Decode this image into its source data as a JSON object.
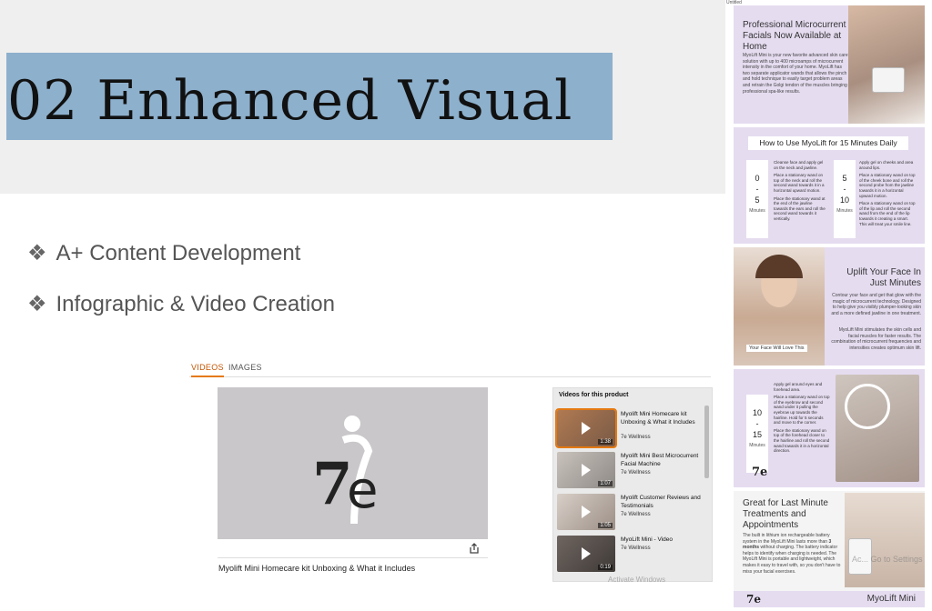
{
  "slide": {
    "title": "02 Enhanced Visual",
    "bullets": [
      {
        "icon": "diamond-bullet-icon",
        "text": "A+ Content Development"
      },
      {
        "icon": "diamond-bullet-icon",
        "text": "Infographic & Video Creation"
      }
    ]
  },
  "video_widget": {
    "tabs": [
      "VIDEOS",
      "IMAGES"
    ],
    "active_tab": "VIDEOS",
    "player_logo": "7e",
    "caption": "Myolift Mini Homecare kit Unboxing & What it Includes",
    "list_header": "Videos for this product",
    "videos": [
      {
        "title": "Myolift Mini Homecare kit Unboxing & What it Includes",
        "brand": "7e Wellness",
        "duration": "1:38"
      },
      {
        "title": "Myolift Mini Best Microcurrent Facial Machine",
        "brand": "7e Wellness",
        "duration": "1:07"
      },
      {
        "title": "Myolift Customer Reviews and Testimonials",
        "brand": "7e Wellness",
        "duration": "1:05"
      },
      {
        "title": "MyoLift Mini - Video",
        "brand": "7e Wellness",
        "duration": "0:19"
      }
    ],
    "watermark": "Activate Windows"
  },
  "infographic": {
    "corner_label": "Untitled",
    "panel1": {
      "title": "Professional Microcurrent Facials Now Available at Home",
      "text": "MyoLift Mini is your new favorite advanced skin care solution with up to 400 microamps of microcurrent intensity in the comfort of your home. MyoLift has two separate applicator wands that allows the pinch and hold technique to easily target problem areas and retrain the Golgi tendon of the muscles bringing professional spa-like results."
    },
    "panel2": {
      "title": "How to Use MyoLift for 15 Minutes Daily",
      "block1": {
        "from": "0",
        "to": "5",
        "unit": "Minutes",
        "steps": [
          "Cleanse face and apply gel on the neck and jawline.",
          "Place a stationary wand on top of the neck and roll the second wand towards it in a horizontal upward motion.",
          "Place the stationary wand at the end of the jawline towards the ears and roll the second wand towards it vertically."
        ]
      },
      "block2": {
        "from": "5",
        "to": "10",
        "unit": "Minutes",
        "steps": [
          "Apply gel on cheeks and area around lips.",
          "Place a stationary wand on top of the cheek bone and roll the second probe from the jawline towards it in a horizontal upward motion.",
          "Place a stationary wand on top of the lip and roll the second wand from the end of the lip towards it creating a smart. This will treat your smile line."
        ]
      }
    },
    "panel3": {
      "title": "Uplift Your Face In Just Minutes",
      "badge": "Your Face Will Love This",
      "text1": "Contour your face and get that glow with the magic of microcurrent technology. Designed to help give you visibly plumper-looking skin and a more defined jawline in one treatment.",
      "text2": "MyoLift Mini stimulates the skin cells and facial muscles for faster results. The combination of microcurrent frequencies and intensities creates optimum skin lift."
    },
    "panel4": {
      "from": "10",
      "to": "15",
      "unit": "Minutes",
      "steps": [
        "Apply gel around eyes and forehead area.",
        "Place a stationary wand on top of the eyebrow and second wand under it pulling the eyebrow up towards the hairline. Hold for 5 seconds and move to the corner.",
        "Place the stationary wand on top of the forehead closer to the hairline and roll the second wand towards it in a horizontal direction."
      ],
      "logo": "7e"
    },
    "panel5": {
      "title": "Great for Last Minute Treatments and Appointments",
      "text_before": "The built in lithium ion rechargeable battery system in the MyoLift Mini lasts more than",
      "text_bold": "3 months",
      "text_after": "without charging. The battery indicator helps to identify when charging is needed. The MyoLift Mini is portable and lightweight, which makes it easy to travel with, so you don't have to miss your facial exercises.",
      "footer_logo": "7e",
      "footer_label": "MyoLift Mini",
      "watermark": "Ac... Go to Settings"
    }
  },
  "colors": {
    "title_box": "#8db0cc",
    "top_band": "#efefef",
    "panel_lavender": "#e5dcf0",
    "tab_active": "#c45500"
  }
}
